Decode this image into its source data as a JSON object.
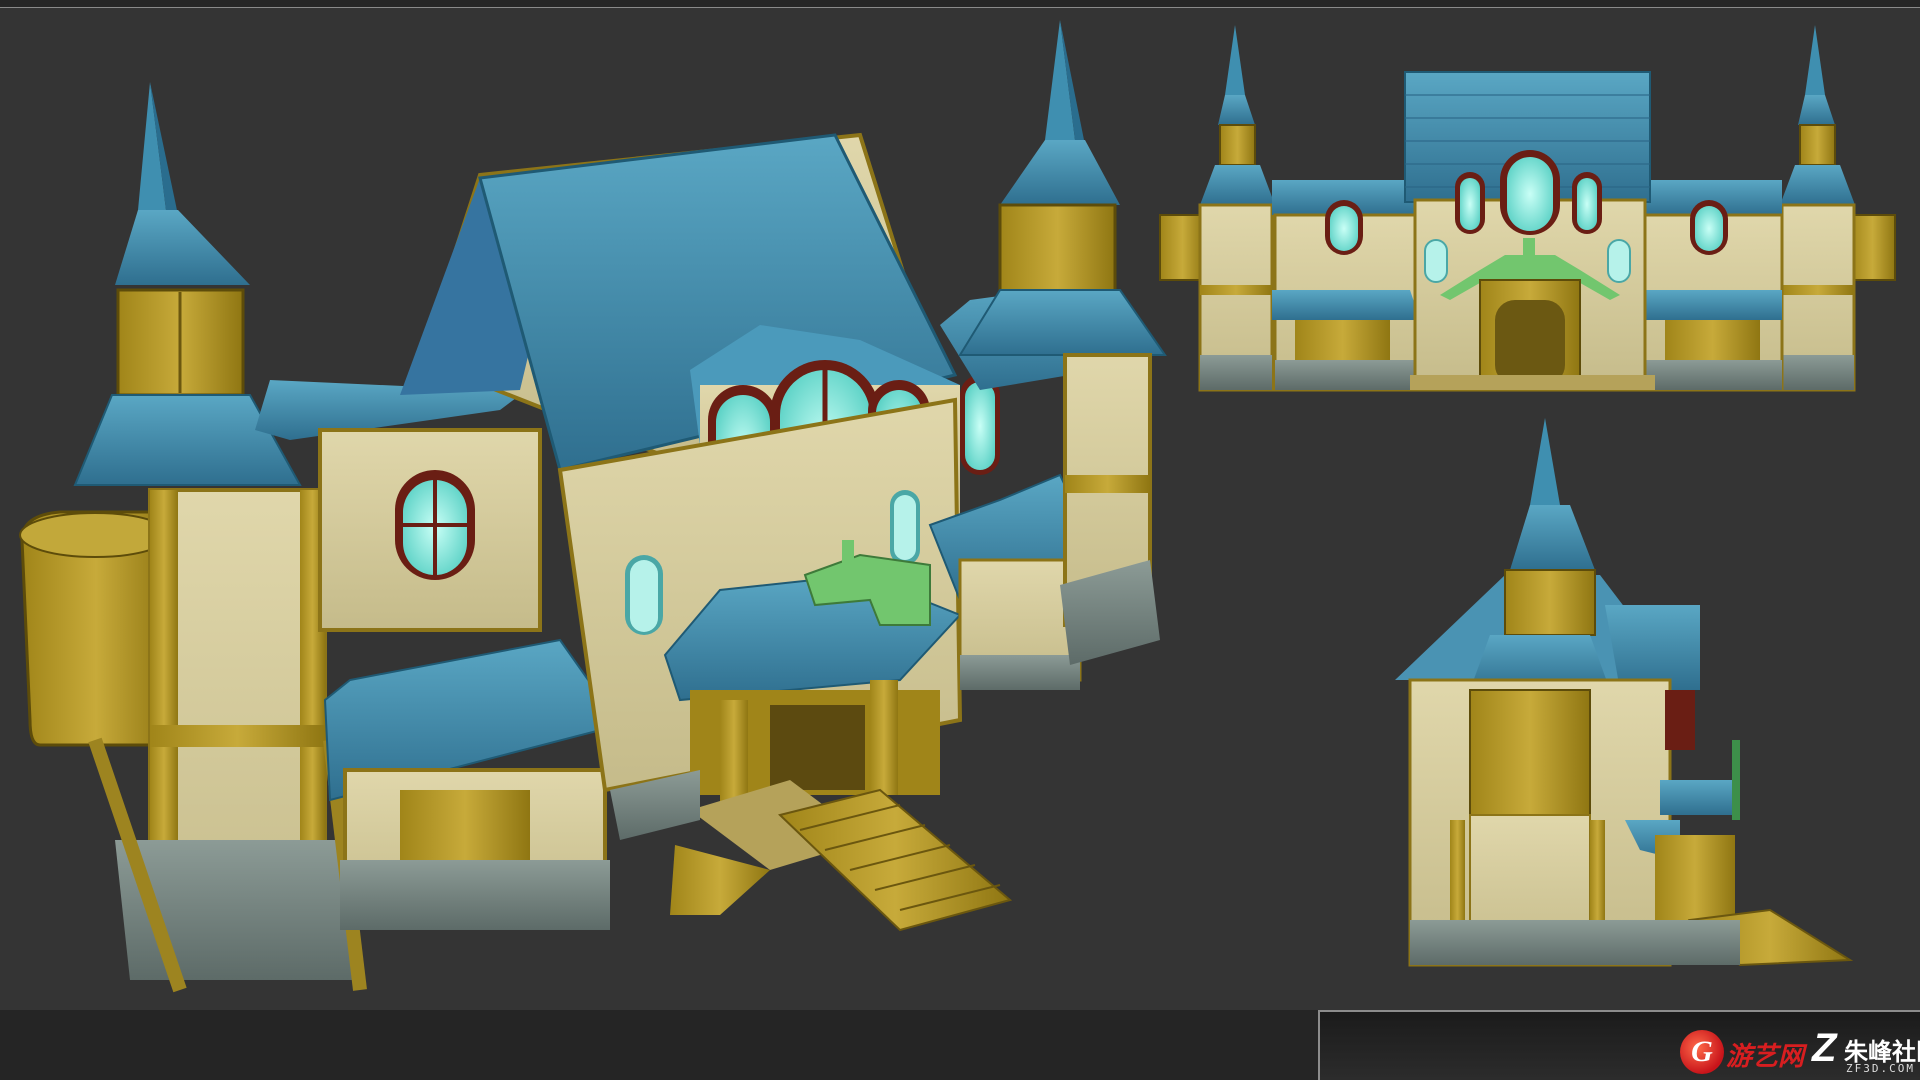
{
  "scene": {
    "views": [
      "perspective-view",
      "front-view",
      "side-view"
    ],
    "colors": {
      "background": "#343434",
      "roof_blue": "#3b86a6",
      "roof_light": "#6bb3cc",
      "wood": "#b59a2a",
      "wood_dark": "#7c6714",
      "plaster": "#d8cfa0",
      "stone": "#7d8c88",
      "window_glow": "#8ff0e6",
      "window_frame": "#6a1e14",
      "trim_green": "#6fc06a"
    }
  },
  "watermark": {
    "logo_letter": "G",
    "site_name_1": "游艺网",
    "logo_z": "Z",
    "site_name_2": "朱峰社区",
    "url": "ZF3D.COM"
  }
}
